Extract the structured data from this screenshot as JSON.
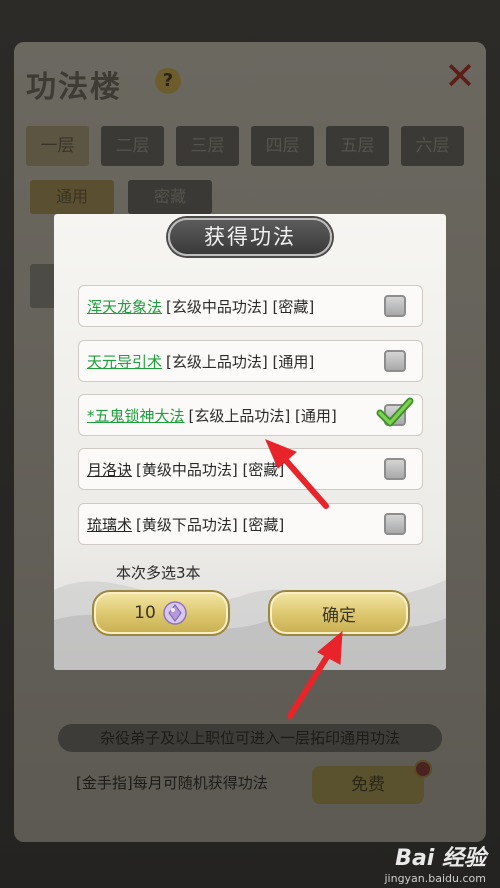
{
  "background": {
    "title": "功法楼",
    "help_icon": "?",
    "close_icon": "close-icon",
    "floor_tabs": [
      "一层",
      "二层",
      "三层",
      "四层",
      "五层",
      "六层"
    ],
    "sub_tabs": [
      "通用",
      "密藏"
    ],
    "notice": "杂役弟子及以上职位可进入一层拓印通用功法",
    "cheat_text": "[金手指]每月可随机获得功法",
    "free_button": "免费"
  },
  "modal": {
    "title": "获得功法",
    "items": [
      {
        "name": "浑天龙象法",
        "info": "[玄级中品功法] [密藏]",
        "name_color": "green",
        "checked": false
      },
      {
        "name": "天元导引术",
        "info": "[玄级上品功法] [通用]",
        "name_color": "green",
        "checked": false
      },
      {
        "name": "*五鬼锁神大法",
        "info": "[玄级上品功法] [通用]",
        "name_color": "green",
        "checked": true
      },
      {
        "name": "月洛诀",
        "info": "[黄级中品功法] [密藏]",
        "name_color": "dark",
        "checked": false
      },
      {
        "name": "琉璃术",
        "info": "[黄级下品功法] [密藏]",
        "name_color": "dark",
        "checked": false
      }
    ],
    "limit_text": "本次多选3本",
    "cost_button": {
      "value": "10",
      "icon": "gem-icon"
    },
    "confirm_button": "确定"
  },
  "watermark": {
    "main": "Bai 经验",
    "sub": "jingyan.baidu.com"
  },
  "colors": {
    "accent_green": "#1e9e3c",
    "gold": "#dcc66c",
    "arrow_red": "#e8242a"
  }
}
